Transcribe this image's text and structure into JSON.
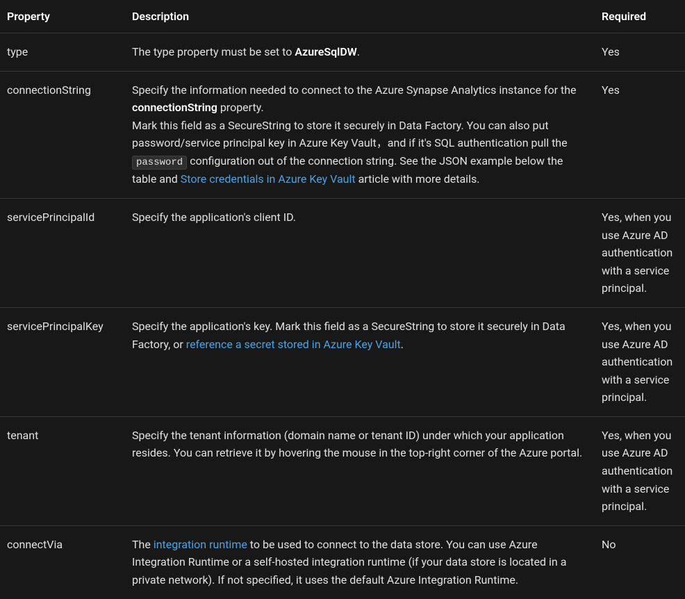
{
  "headers": {
    "property": "Property",
    "description": "Description",
    "required": "Required"
  },
  "rows": {
    "type": {
      "property": "type",
      "desc_prefix": "The type property must be set to ",
      "desc_bold": "AzureSqlDW",
      "desc_suffix": ".",
      "required": "Yes"
    },
    "connectionString": {
      "property": "connectionString",
      "line1_prefix": "Specify the information needed to connect to the Azure Synapse Analytics instance for the ",
      "line1_bold": "connectionString",
      "line1_suffix": " property.",
      "line2_prefix": "Mark this field as a SecureString to store it securely in Data Factory. You can also put password/service principal key in Azure Key Vault，and if it's SQL authentication pull the ",
      "line2_code": "password",
      "line2_mid": " configuration out of the connection string. See the JSON example below the table and ",
      "line2_link": "Store credentials in Azure Key Vault",
      "line2_suffix": " article with more details.",
      "required": "Yes"
    },
    "servicePrincipalId": {
      "property": "servicePrincipalId",
      "desc": "Specify the application's client ID.",
      "required": "Yes, when you use Azure AD authentication with a service principal."
    },
    "servicePrincipalKey": {
      "property": "servicePrincipalKey",
      "desc_prefix": "Specify the application's key. Mark this field as a SecureString to store it securely in Data Factory, or ",
      "desc_link": "reference a secret stored in Azure Key Vault",
      "desc_suffix": ".",
      "required": "Yes, when you use Azure AD authentication with a service principal."
    },
    "tenant": {
      "property": "tenant",
      "desc": "Specify the tenant information (domain name or tenant ID) under which your application resides. You can retrieve it by hovering the mouse in the top-right corner of the Azure portal.",
      "required": "Yes, when you use Azure AD authentication with a service principal."
    },
    "connectVia": {
      "property": "connectVia",
      "desc_prefix": "The ",
      "desc_link": "integration runtime",
      "desc_suffix": " to be used to connect to the data store. You can use Azure Integration Runtime or a self-hosted integration runtime (if your data store is located in a private network). If not specified, it uses the default Azure Integration Runtime.",
      "required": "No"
    }
  }
}
